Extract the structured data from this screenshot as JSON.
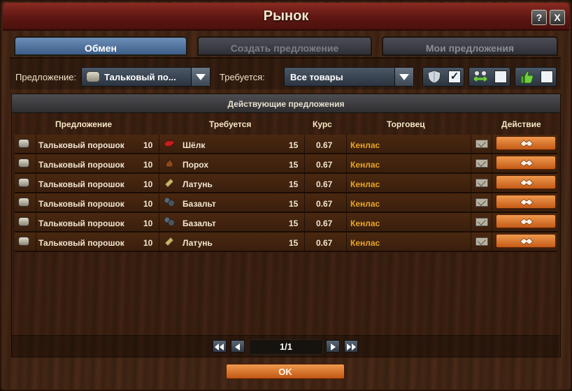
{
  "window": {
    "title": "Рынок",
    "help_label": "?",
    "close_label": "X"
  },
  "tabs": [
    {
      "label": "Обмен",
      "active": true
    },
    {
      "label": "Создать предложение",
      "active": false
    },
    {
      "label": "Мои предложения",
      "active": false
    }
  ],
  "filters": {
    "offer_label": "Предложение:",
    "offer_value": "Тальковый по...",
    "offer_icon": "talc-powder-icon",
    "need_label": "Требуется:",
    "need_value": "Все товары",
    "toggles": [
      {
        "icon": "shield-icon",
        "checked": true,
        "check_mark": "✓"
      },
      {
        "icon": "traders-exchange-icon",
        "checked": false,
        "check_mark": ""
      },
      {
        "icon": "thumbs-up-icon",
        "checked": false,
        "check_mark": ""
      }
    ]
  },
  "panel": {
    "title": "Действующие предложения",
    "columns": {
      "offer": "Предложение",
      "need": "Требуется",
      "rate": "Курс",
      "trader": "Торговец",
      "action": "Действие"
    }
  },
  "rows": [
    {
      "offer": "Тальковый порошок",
      "offer_amount": "10",
      "need": "Шёлк",
      "need_icon": "silk-icon",
      "need_amount": "15",
      "rate": "0.67",
      "trader": "Кенлас"
    },
    {
      "offer": "Тальковый порошок",
      "offer_amount": "10",
      "need": "Порох",
      "need_icon": "gunpowder-icon",
      "need_amount": "15",
      "rate": "0.67",
      "trader": "Кенлас"
    },
    {
      "offer": "Тальковый порошок",
      "offer_amount": "10",
      "need": "Латунь",
      "need_icon": "brass-icon",
      "need_amount": "15",
      "rate": "0.67",
      "trader": "Кенлас"
    },
    {
      "offer": "Тальковый порошок",
      "offer_amount": "10",
      "need": "Базальт",
      "need_icon": "basalt-icon",
      "need_amount": "15",
      "rate": "0.67",
      "trader": "Кенлас"
    },
    {
      "offer": "Тальковый порошок",
      "offer_amount": "10",
      "need": "Базальт",
      "need_icon": "basalt-icon",
      "need_amount": "15",
      "rate": "0.67",
      "trader": "Кенлас"
    },
    {
      "offer": "Тальковый порошок",
      "offer_amount": "10",
      "need": "Латунь",
      "need_icon": "brass-icon",
      "need_amount": "15",
      "rate": "0.67",
      "trader": "Кенлас"
    }
  ],
  "pager": {
    "page_text": "1/1"
  },
  "footer": {
    "ok_label": "OK"
  },
  "colors": {
    "trader_name": "#e7a526",
    "action_button": "#d9742c",
    "active_tab": "#4f7099"
  }
}
